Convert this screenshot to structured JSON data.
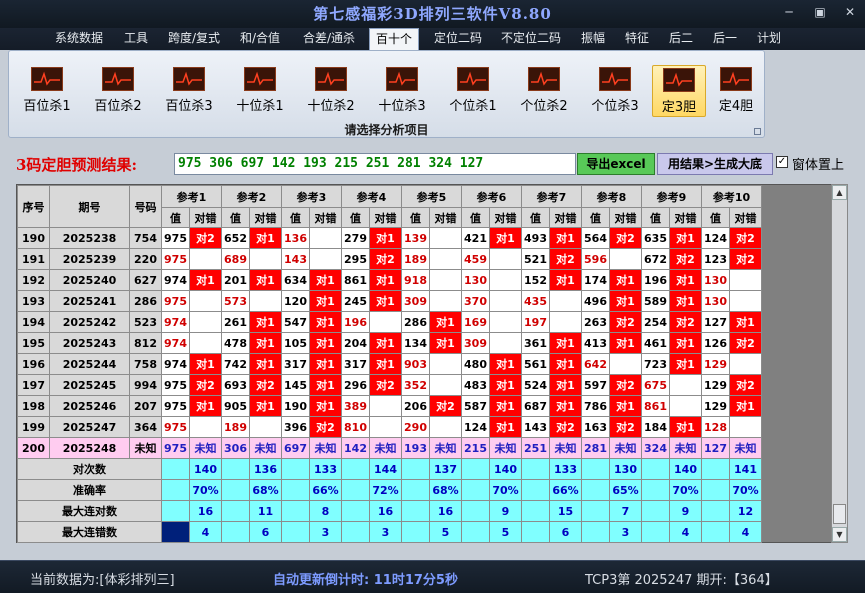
{
  "window": {
    "title": "第七感福彩3D排列三软件V8.80",
    "min": "─",
    "restore": "▣",
    "close": "✕"
  },
  "menu": [
    "系统数据",
    "工具",
    "跨度/复式",
    "和/合值",
    "合差/通杀",
    "百十个",
    "定位二码",
    "不定位二码",
    "振幅",
    "特征",
    "后二",
    "后一",
    "计划"
  ],
  "menu_active": 5,
  "ribbon": {
    "buttons": [
      "百位杀1",
      "百位杀2",
      "百位杀3",
      "十位杀1",
      "十位杀2",
      "十位杀3",
      "个位杀1",
      "个位杀2",
      "个位杀3",
      "定3胆",
      "定4胆"
    ],
    "selected": 9,
    "caption": "请选择分析项目"
  },
  "result": {
    "label": "3码定胆预测结果:",
    "values": "975 306 697 142 193 215 251 281 324 127",
    "excel_btn": "导出excel",
    "gen_btn": "用结果>生成大底",
    "topmost_label": "窗体置上",
    "topmost_checked": true
  },
  "grid": {
    "headers": {
      "idx": "序号",
      "issue": "期号",
      "num": "号码",
      "val": "值",
      "hit": "对错"
    },
    "refs": [
      "参考1",
      "参考2",
      "参考3",
      "参考4",
      "参考5",
      "参考6",
      "参考7",
      "参考8",
      "参考9",
      "参考10"
    ],
    "rows": [
      {
        "idx": "190",
        "issue": "2025238",
        "num": "754",
        "cells": [
          [
            "975",
            "对2"
          ],
          [
            "652",
            "对1"
          ],
          [
            "136",
            ""
          ],
          [
            "279",
            "对1"
          ],
          [
            "139",
            ""
          ],
          [
            "421",
            "对1"
          ],
          [
            "493",
            "对1"
          ],
          [
            "564",
            "对2"
          ],
          [
            "635",
            "对1"
          ],
          [
            "124",
            "对2"
          ]
        ]
      },
      {
        "idx": "191",
        "issue": "2025239",
        "num": "220",
        "cells": [
          [
            "975",
            ""
          ],
          [
            "689",
            ""
          ],
          [
            "143",
            ""
          ],
          [
            "295",
            "对2"
          ],
          [
            "189",
            ""
          ],
          [
            "459",
            ""
          ],
          [
            "521",
            "对2"
          ],
          [
            "596",
            ""
          ],
          [
            "672",
            "对2"
          ],
          [
            "123",
            "对2"
          ]
        ]
      },
      {
        "idx": "192",
        "issue": "2025240",
        "num": "627",
        "cells": [
          [
            "974",
            "对1"
          ],
          [
            "201",
            "对1"
          ],
          [
            "634",
            "对1"
          ],
          [
            "861",
            "对1"
          ],
          [
            "918",
            ""
          ],
          [
            "130",
            ""
          ],
          [
            "152",
            "对1"
          ],
          [
            "174",
            "对1"
          ],
          [
            "196",
            "对1"
          ],
          [
            "130",
            ""
          ]
        ]
      },
      {
        "idx": "193",
        "issue": "2025241",
        "num": "286",
        "cells": [
          [
            "975",
            ""
          ],
          [
            "573",
            ""
          ],
          [
            "120",
            "对1"
          ],
          [
            "245",
            "对1"
          ],
          [
            "309",
            ""
          ],
          [
            "370",
            ""
          ],
          [
            "435",
            ""
          ],
          [
            "496",
            "对1"
          ],
          [
            "589",
            "对1"
          ],
          [
            "130",
            ""
          ]
        ]
      },
      {
        "idx": "194",
        "issue": "2025242",
        "num": "523",
        "cells": [
          [
            "974",
            ""
          ],
          [
            "261",
            "对1"
          ],
          [
            "547",
            "对1"
          ],
          [
            "196",
            ""
          ],
          [
            "286",
            "对1"
          ],
          [
            "169",
            ""
          ],
          [
            "197",
            ""
          ],
          [
            "263",
            "对2"
          ],
          [
            "254",
            "对2"
          ],
          [
            "127",
            "对1"
          ]
        ]
      },
      {
        "idx": "195",
        "issue": "2025243",
        "num": "812",
        "cells": [
          [
            "974",
            ""
          ],
          [
            "478",
            "对1"
          ],
          [
            "105",
            "对1"
          ],
          [
            "204",
            "对1"
          ],
          [
            "134",
            "对1"
          ],
          [
            "309",
            ""
          ],
          [
            "361",
            "对1"
          ],
          [
            "413",
            "对1"
          ],
          [
            "461",
            "对1"
          ],
          [
            "126",
            "对2"
          ]
        ]
      },
      {
        "idx": "196",
        "issue": "2025244",
        "num": "758",
        "cells": [
          [
            "974",
            "对1"
          ],
          [
            "742",
            "对1"
          ],
          [
            "317",
            "对1"
          ],
          [
            "317",
            "对1"
          ],
          [
            "903",
            ""
          ],
          [
            "480",
            "对1"
          ],
          [
            "561",
            "对1"
          ],
          [
            "642",
            ""
          ],
          [
            "723",
            "对1"
          ],
          [
            "129",
            ""
          ]
        ]
      },
      {
        "idx": "197",
        "issue": "2025245",
        "num": "994",
        "cells": [
          [
            "975",
            "对2"
          ],
          [
            "693",
            "对2"
          ],
          [
            "145",
            "对1"
          ],
          [
            "296",
            "对2"
          ],
          [
            "352",
            ""
          ],
          [
            "483",
            "对1"
          ],
          [
            "524",
            "对1"
          ],
          [
            "597",
            "对2"
          ],
          [
            "675",
            ""
          ],
          [
            "129",
            "对2"
          ]
        ]
      },
      {
        "idx": "198",
        "issue": "2025246",
        "num": "207",
        "cells": [
          [
            "975",
            "对1"
          ],
          [
            "905",
            "对1"
          ],
          [
            "190",
            "对1"
          ],
          [
            "389",
            ""
          ],
          [
            "206",
            "对2"
          ],
          [
            "587",
            "对1"
          ],
          [
            "687",
            "对1"
          ],
          [
            "786",
            "对1"
          ],
          [
            "861",
            ""
          ],
          [
            "129",
            "对1"
          ]
        ]
      },
      {
        "idx": "199",
        "issue": "2025247",
        "num": "364",
        "cells": [
          [
            "975",
            ""
          ],
          [
            "189",
            ""
          ],
          [
            "396",
            "对2"
          ],
          [
            "810",
            ""
          ],
          [
            "290",
            ""
          ],
          [
            "124",
            "对1"
          ],
          [
            "143",
            "对2"
          ],
          [
            "163",
            "对2"
          ],
          [
            "184",
            "对1"
          ],
          [
            "128",
            ""
          ]
        ]
      },
      {
        "idx": "200",
        "issue": "2025248",
        "num": "未知",
        "cells": [
          [
            "975",
            "未知"
          ],
          [
            "306",
            "未知"
          ],
          [
            "697",
            "未知"
          ],
          [
            "142",
            "未知"
          ],
          [
            "193",
            "未知"
          ],
          [
            "215",
            "未知"
          ],
          [
            "251",
            "未知"
          ],
          [
            "281",
            "未知"
          ],
          [
            "324",
            "未知"
          ],
          [
            "127",
            "未知"
          ]
        ]
      }
    ],
    "stats": [
      {
        "label": "对次数",
        "values": [
          "140",
          "136",
          "133",
          "144",
          "137",
          "140",
          "133",
          "130",
          "140",
          "141"
        ]
      },
      {
        "label": "准确率",
        "values": [
          "70%",
          "68%",
          "66%",
          "72%",
          "68%",
          "70%",
          "66%",
          "65%",
          "70%",
          "70%"
        ]
      },
      {
        "label": "最大连对数",
        "values": [
          "16",
          "11",
          "8",
          "16",
          "16",
          "9",
          "15",
          "7",
          "9",
          "12"
        ]
      },
      {
        "label": "最大连错数",
        "values": [
          "4",
          "6",
          "3",
          "3",
          "5",
          "5",
          "6",
          "3",
          "4",
          "4"
        ]
      }
    ]
  },
  "status": {
    "data_source": "当前数据为:[体彩排列三]",
    "countdown": "自动更新倒计时:  11时17分5秒",
    "tcp": "TCP3第 2025247 期开:【364】"
  },
  "colors": {
    "hit": "#ff0000",
    "predict_row": "#ffccf0",
    "stat_bg": "#80ffff",
    "result_green": "#008000"
  }
}
